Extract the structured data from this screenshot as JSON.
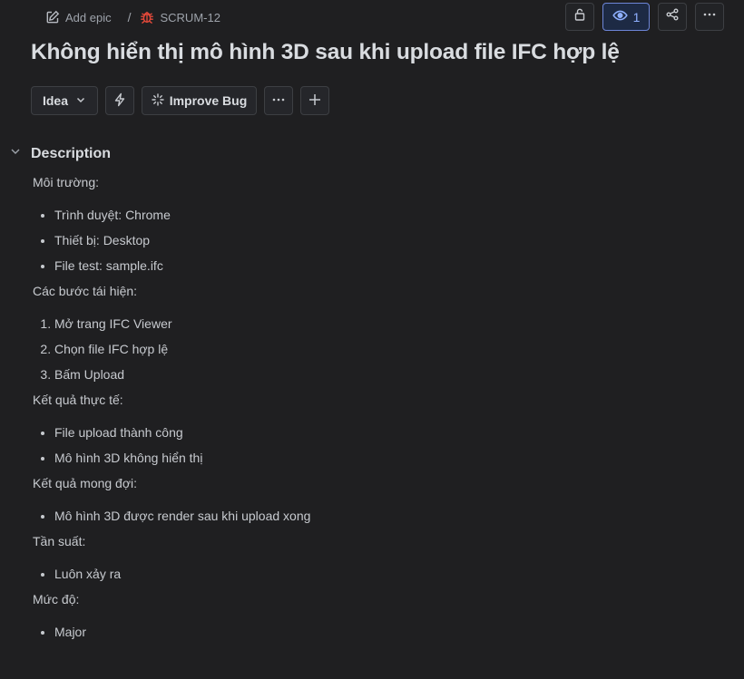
{
  "breadcrumb": {
    "add_epic": "Add epic",
    "separator": "/",
    "issue_key": "SCRUM-12",
    "issue_icon": "bug-icon",
    "issue_icon_color": "#e5493a"
  },
  "header_actions": {
    "watchers_count": "1",
    "icons": [
      "lock-icon",
      "eye-icon",
      "share-icon",
      "more-horizontal-icon"
    ]
  },
  "title": "Không hiển thị mô hình 3D sau khi upload file IFC hợp lệ",
  "toolbar": {
    "status_label": "Idea",
    "improve_label": "Improve Bug"
  },
  "description": {
    "heading": "Description",
    "sections": [
      {
        "heading": "Môi trường:",
        "type": "bullet",
        "items": [
          "Trình duyệt: Chrome",
          "Thiết bị: Desktop",
          "File test: sample.ifc"
        ]
      },
      {
        "heading": "Các bước tái hiện:",
        "type": "numbered",
        "items": [
          "Mở trang IFC Viewer",
          "Chọn file IFC hợp lệ",
          "Bấm Upload"
        ]
      },
      {
        "heading": "Kết quả thực tế:",
        "type": "bullet",
        "items": [
          "File upload thành công",
          "Mô hình 3D không hiển thị"
        ]
      },
      {
        "heading": "Kết quả mong đợi:",
        "type": "bullet",
        "items": [
          "Mô hình 3D được render sau khi upload xong"
        ]
      },
      {
        "heading": "Tần suất:",
        "type": "bullet",
        "items": [
          "Luôn xảy ra"
        ]
      },
      {
        "heading": "Mức độ:",
        "type": "bullet",
        "items": [
          "Major"
        ]
      }
    ]
  },
  "colors": {
    "background": "#1f1f21",
    "text": "#c7cacf",
    "heading": "#d9dce0",
    "watch_accent": "#8fb0ff"
  }
}
